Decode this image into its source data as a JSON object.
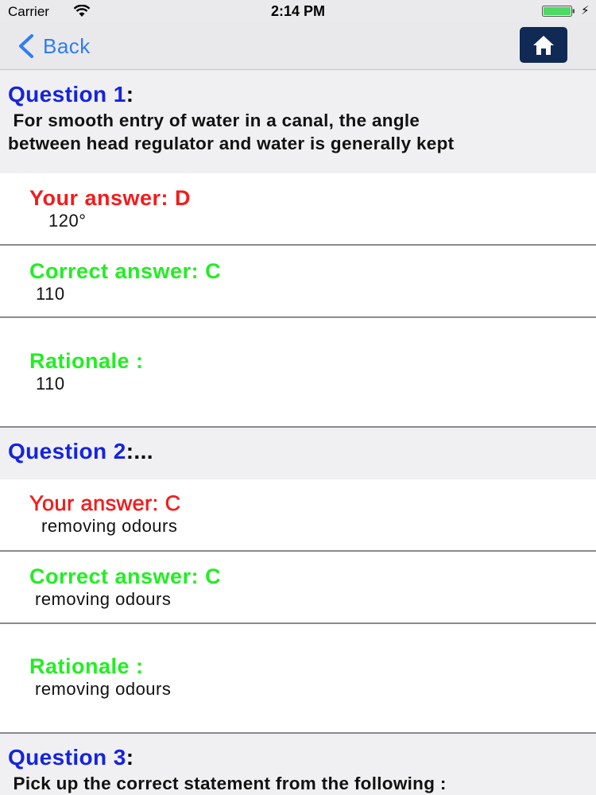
{
  "status_bar": {
    "carrier": "Carrier",
    "time": "2:14 PM"
  },
  "nav": {
    "back_label": "Back",
    "home_icon": "home-icon"
  },
  "colors": {
    "question_title": "#1523e0",
    "your_answer": "#f21c1c",
    "correct_answer": "#22ee22",
    "home_button": "#102955",
    "back_link": "#2f7cf6"
  },
  "questions": [
    {
      "title": "Question 1",
      "colon": ":",
      "text": " For smooth entry of water in a canal, the angle\nbetween head regulator and water is generally kept",
      "your_answer_label": "Your answer: D",
      "your_answer_text": "120°",
      "correct_answer_label": "Correct answer: C",
      "correct_answer_text": "110",
      "rationale_label": "Rationale :",
      "rationale_text": "110"
    },
    {
      "title": "Question 2",
      "colon": ":...",
      "your_answer_label": "Your answer: C",
      "your_answer_text": "removing odours",
      "correct_answer_label": "Correct answer: C",
      "correct_answer_text": "removing odours",
      "rationale_label": "Rationale :",
      "rationale_text": "removing odours"
    },
    {
      "title": "Question 3",
      "colon": ":",
      "text": " Pick up the correct statement from the following :"
    }
  ]
}
